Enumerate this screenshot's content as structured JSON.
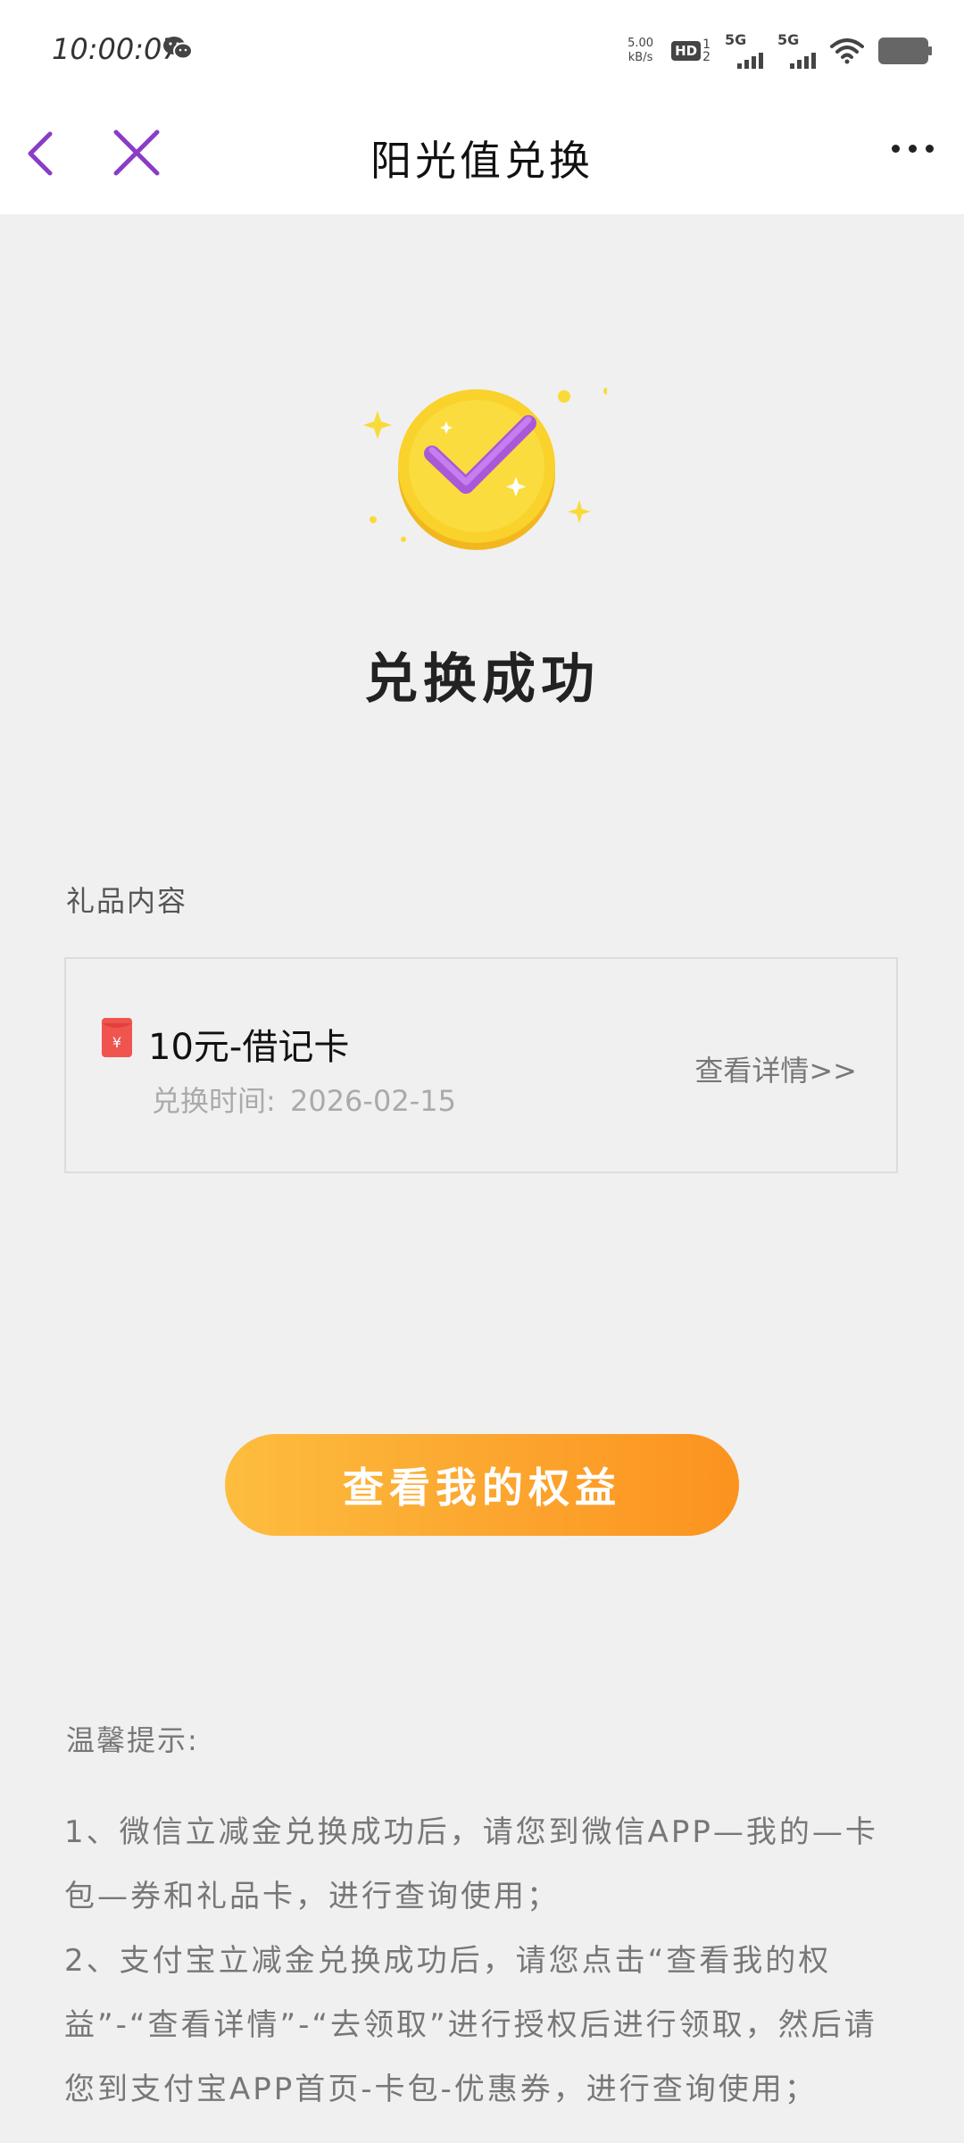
{
  "status_bar": {
    "time": "10:00:07",
    "net_speed_value": "5.00",
    "net_speed_unit": "kB/s",
    "hd_label": "HD",
    "hd_sub_top": "1",
    "hd_sub_bottom": "2",
    "sim1_label": "5G",
    "sim2_label": "5G"
  },
  "nav": {
    "title": "阳光值兑换"
  },
  "result": {
    "title": "兑换成功"
  },
  "gift": {
    "section_label": "礼品内容",
    "name": "10元-借记卡",
    "time_label": "兑换时间:",
    "time_value": "2026-02-15",
    "detail_link": "查看详情>>",
    "icon_symbol": "¥"
  },
  "action": {
    "rights_button": "查看我的权益"
  },
  "tips": {
    "title": "温馨提示:",
    "item1": "1、微信立减金兑换成功后，请您到微信APP—我的—卡包—券和礼品卡，进行查询使用；",
    "item2": "2、支付宝立减金兑换成功后，请您点击“查看我的权益”-“查看详情”-“去领取”进行授权后进行领取，然后请您到支付宝APP首页-卡包-优惠券，进行查询使用；"
  },
  "colors": {
    "accent_purple": "#8a3cc8",
    "button_orange_start": "#fdbd3e",
    "button_orange_end": "#fb931e",
    "coin_yellow": "#f9d22c"
  }
}
